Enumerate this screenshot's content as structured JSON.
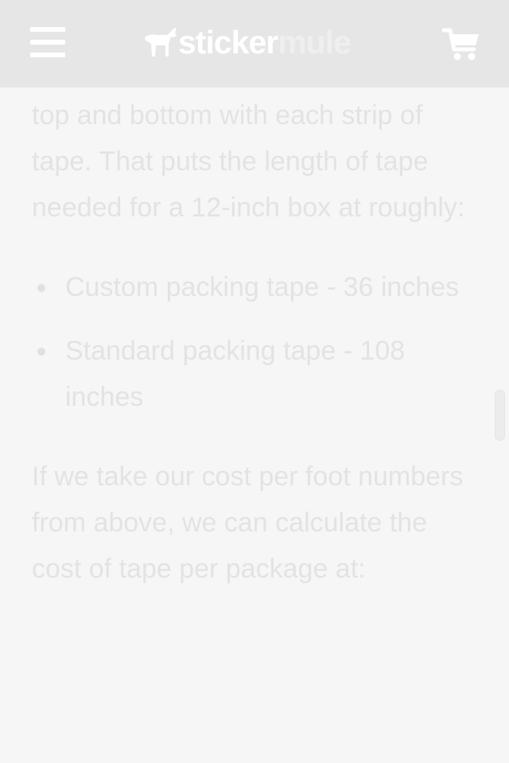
{
  "header": {
    "logo_part1": "sticker",
    "logo_part2": "mule",
    "menu_icon": "hamburger-menu-icon",
    "cart_icon": "shopping-cart-icon",
    "logo_icon": "mule-icon",
    "colors": {
      "bar_background": "#e6e6e6",
      "icon_color": "#ffffff"
    }
  },
  "article": {
    "paragraph1": "top and bottom with each strip of tape. That puts the length of tape needed for a 12-inch box at roughly:",
    "list": [
      {
        "text": "Custom packing tape - 36 inches"
      },
      {
        "text": "Standard packing tape - 108 inches"
      }
    ],
    "paragraph2": "If we take our cost per foot numbers from above, we can calculate the cost of tape per package at:"
  }
}
